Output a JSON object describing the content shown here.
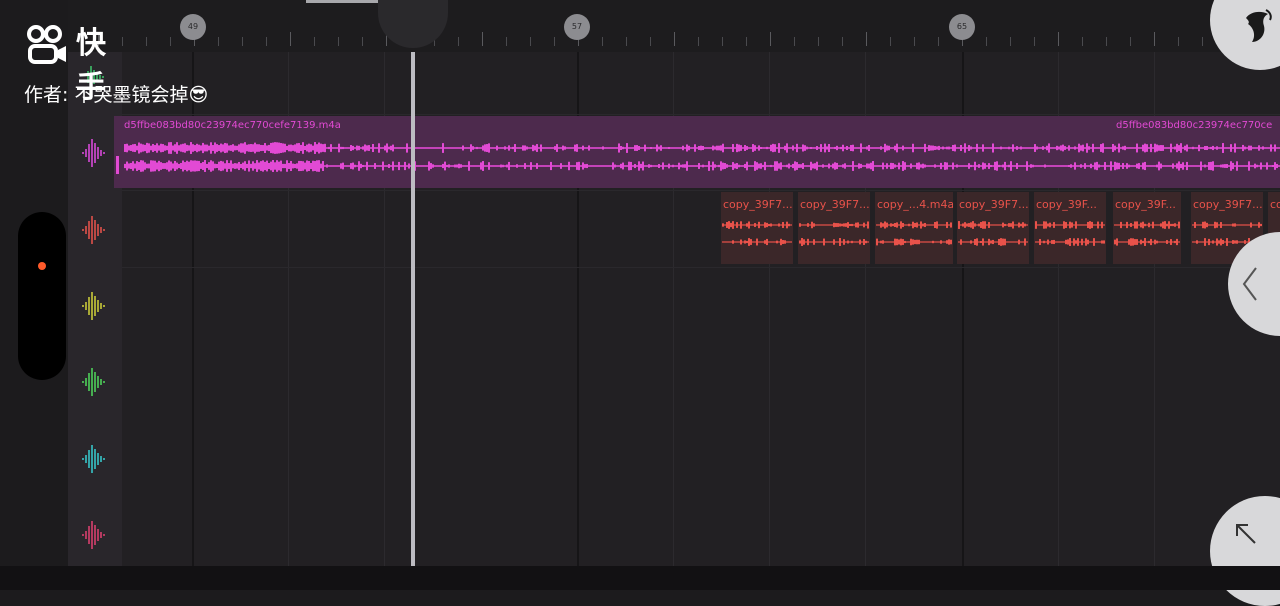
{
  "watermark": {
    "brand": "快手",
    "author_prefix": "作者:",
    "author_name": "不哭墨镜会掉😎"
  },
  "ruler": {
    "markers": [
      "49",
      "57",
      "65"
    ]
  },
  "tracks": {
    "icons": [
      {
        "name": "track-1-waveform-icon",
        "color": "#3fbf6a"
      },
      {
        "name": "track-2-waveform-icon",
        "color": "#d84ad8"
      },
      {
        "name": "track-3-waveform-icon",
        "color": "#e0504a"
      },
      {
        "name": "track-4-waveform-icon",
        "color": "#c9c93a"
      },
      {
        "name": "track-5-waveform-icon",
        "color": "#4ecf5a"
      },
      {
        "name": "track-6-waveform-icon",
        "color": "#38c4c8"
      },
      {
        "name": "track-7-waveform-icon",
        "color": "#d8406e"
      }
    ]
  },
  "clips": {
    "pink": {
      "label_left": "d5ffbe083bd80c23974ec770cefe7139.m4a",
      "label_right": "d5ffbe083bd80c23974ec770ce",
      "color": "#e24ad4"
    },
    "red": [
      {
        "label": "copy_39F7..."
      },
      {
        "label": "copy_39F7..."
      },
      {
        "label": "copy_...4.m4a"
      },
      {
        "label": "copy_39F7..."
      },
      {
        "label": "copy_39F..."
      },
      {
        "label": "copy_39F..."
      },
      {
        "label": "copy_39F7..."
      },
      {
        "label": "co"
      }
    ]
  },
  "colors": {
    "accent_pink": "#e24ad4",
    "accent_red": "#e8524a",
    "record_dot": "#ff5a2a"
  }
}
